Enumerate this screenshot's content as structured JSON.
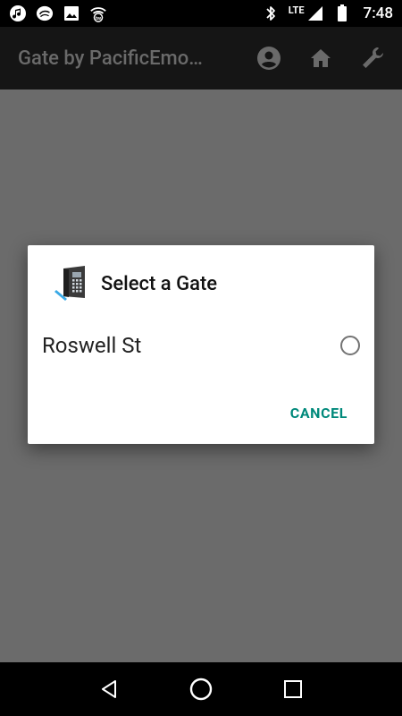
{
  "status_bar": {
    "left_icons": [
      "music-note-icon",
      "media-sync-icon",
      "image-icon",
      "wifi-tw-icon"
    ],
    "right_icons": [
      "bluetooth-icon",
      "lte-signal-icon",
      "battery-icon"
    ],
    "network_label": "LTE",
    "time": "7:48"
  },
  "app_bar": {
    "title": "Gate by PacificEmo…",
    "actions": [
      "account-icon",
      "home-icon",
      "wrench-icon"
    ]
  },
  "dialog": {
    "title": "Select a Gate",
    "icon": "gate-keypad-icon",
    "options": [
      {
        "label": "Roswell St",
        "selected": false
      }
    ],
    "cancel_label": "CANCEL"
  },
  "colors": {
    "accent": "#00897b",
    "scrim": "#6b6b6b",
    "app_bar": "#151515"
  },
  "nav_bar": {
    "buttons": [
      "back-icon",
      "home-circle-icon",
      "recents-icon"
    ]
  }
}
